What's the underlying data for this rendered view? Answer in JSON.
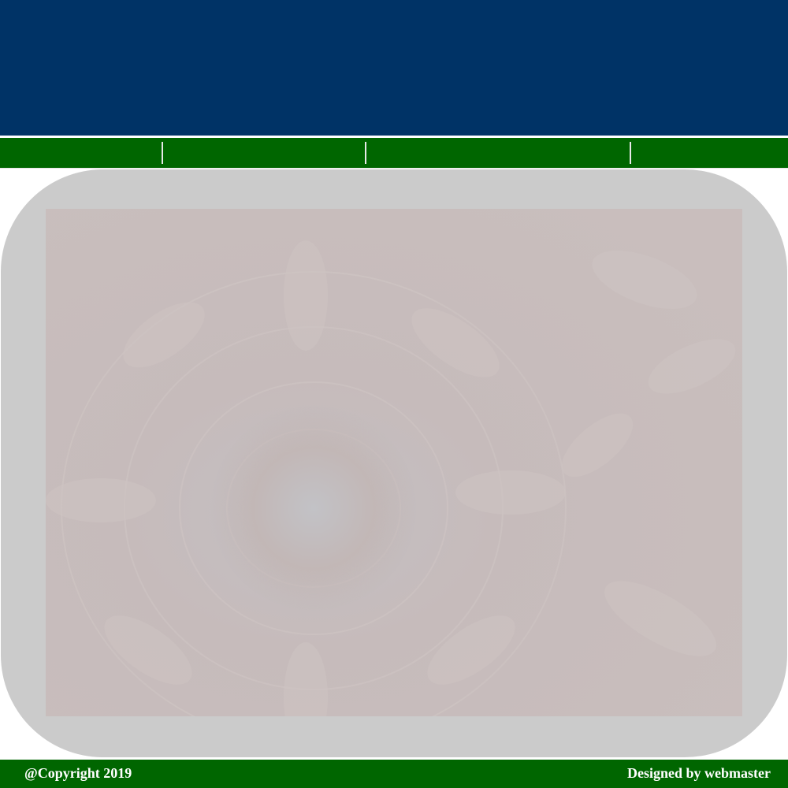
{
  "header": {
    "background_color": "#003366"
  },
  "nav": {
    "background_color": "#006600",
    "items": [
      {
        "label": ""
      },
      {
        "label": ""
      },
      {
        "label": ""
      },
      {
        "label": ""
      }
    ]
  },
  "content": {
    "panel_color": "#cbcbcb",
    "image": {
      "subject": "chrysanthemum flower close-up",
      "icon": "flower-photo"
    }
  },
  "footer": {
    "background_color": "#006600",
    "copyright": "@Copyright 2019",
    "credit": "Designed by webmaster"
  }
}
